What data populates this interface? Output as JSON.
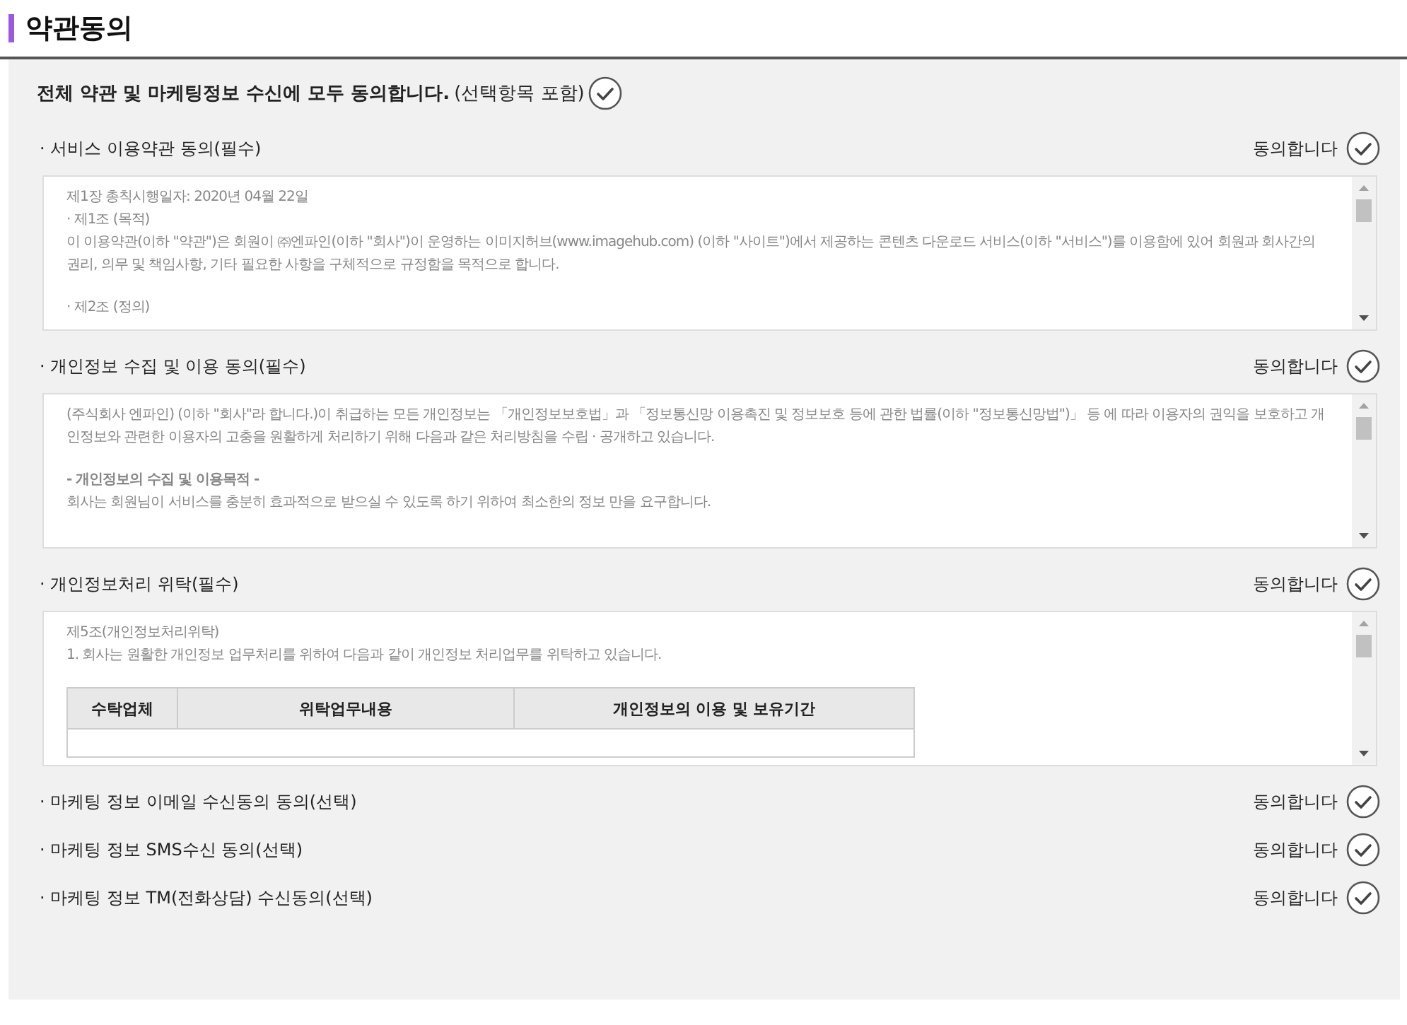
{
  "title": "약관동의",
  "agree_all": {
    "label": "전체 약관 및 마케팅정보 수신에 모두 동의합니다.",
    "note": "(선택항목 포함)",
    "checked": false
  },
  "sections": [
    {
      "kind": "text",
      "label": "· 서비스 이용약관 동의(필수)",
      "agree_label": "동의합니다",
      "checked": false,
      "paragraphs": [
        [
          "제1장 총칙시행일자: 2020년 04월 22일",
          "  ·  제1조 (목적)",
          "이 이용약관(이하 \"약관\")은 회원이 ㈜엔파인(이하 \"회사\")이 운영하는 이미지허브(www.imagehub.com) (이하 \"사이트\")에서 제공하는 콘텐츠 다운로드 서비스(이하 \"서비스\")를 이용함에 있어 회원과 회사간의 권리, 의무 및 책임사항, 기타 필요한 사항을 구체적으로 규정함을 목적으로 합니다."
        ],
        [
          "  · 제2조 (정의)"
        ]
      ]
    },
    {
      "kind": "text",
      "label": "· 개인정보 수집 및 이용 동의(필수)",
      "agree_label": "동의합니다",
      "checked": false,
      "paragraphs": [
        [
          "(주식회사 엔파인) (이하 \"회사\"라 합니다.)이 취급하는 모든 개인정보는 「개인정보보호법」과 「정보통신망 이용촉진 및 정보보호 등에 관한 법률(이하 \"정보통신망법\")」 등 에 따라 이용자의 권익을 보호하고 개인정보와 관련한 이용자의 고충을 원활하게 처리하기 위해 다음과 같은 처리방침을 수립 · 공개하고 있습니다."
        ],
        [
          "**- 개인정보의 수집 및 이용목적 -**",
          "회사는 회원님이 서비스를 충분히 효과적으로 받으실 수 있도록 하기 위하여 최소한의 정보 만을 요구합니다."
        ]
      ]
    },
    {
      "kind": "table",
      "label": "· 개인정보처리 위탁(필수)",
      "agree_label": "동의합니다",
      "checked": false,
      "paragraphs": [
        [
          "제5조(개인정보처리위탁)",
          "1. 회사는 원활한 개인정보 업무처리를 위하여 다음과 같이 개인정보 처리업무를 위탁하고 있습니다."
        ]
      ],
      "columns": [
        "수탁업체",
        "위탁업무내용",
        "개인정보의 이용 및 보유기간"
      ]
    },
    {
      "kind": "plain",
      "label": "· 마케팅 정보 이메일 수신동의 동의(선택)",
      "agree_label": "동의합니다",
      "checked": false
    },
    {
      "kind": "plain",
      "label": "· 마케팅 정보 SMS수신 동의(선택)",
      "agree_label": "동의합니다",
      "checked": false
    },
    {
      "kind": "plain",
      "label": "· 마케팅 정보 TM(전화상담) 수신동의(선택)",
      "agree_label": "동의합니다",
      "checked": false
    }
  ]
}
